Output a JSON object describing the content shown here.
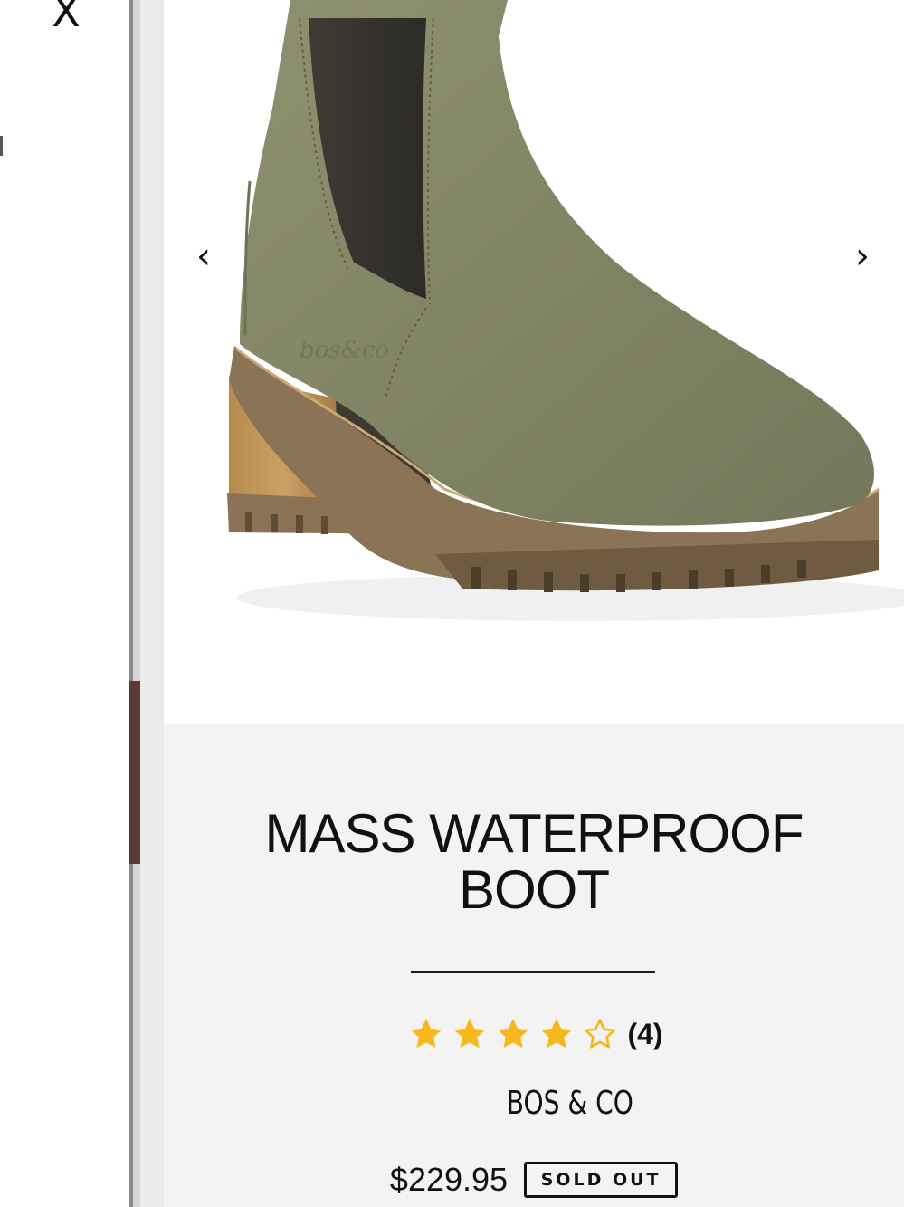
{
  "close": {
    "icon": "close-icon",
    "label": "X"
  },
  "carousel": {
    "prev_icon": "chevron-left-icon",
    "next_icon": "chevron-right-icon",
    "prev_glyph": "‹",
    "next_glyph": "›"
  },
  "product": {
    "title_line1": "MASS WATERPROOF",
    "title_line2": "BOOT",
    "rating": 4,
    "rating_max": 5,
    "review_count": "(4)",
    "brand": "BOS & CO",
    "price": "$229.95",
    "status_badge": "SOLD OUT"
  },
  "colors": {
    "star_filled": "#f6b81d",
    "star_empty_stroke": "#f6b81d",
    "boot_suede": "#8c8f6c",
    "panel_bg": "#f3f3f3",
    "scroll_thumb": "#5b3a34"
  }
}
